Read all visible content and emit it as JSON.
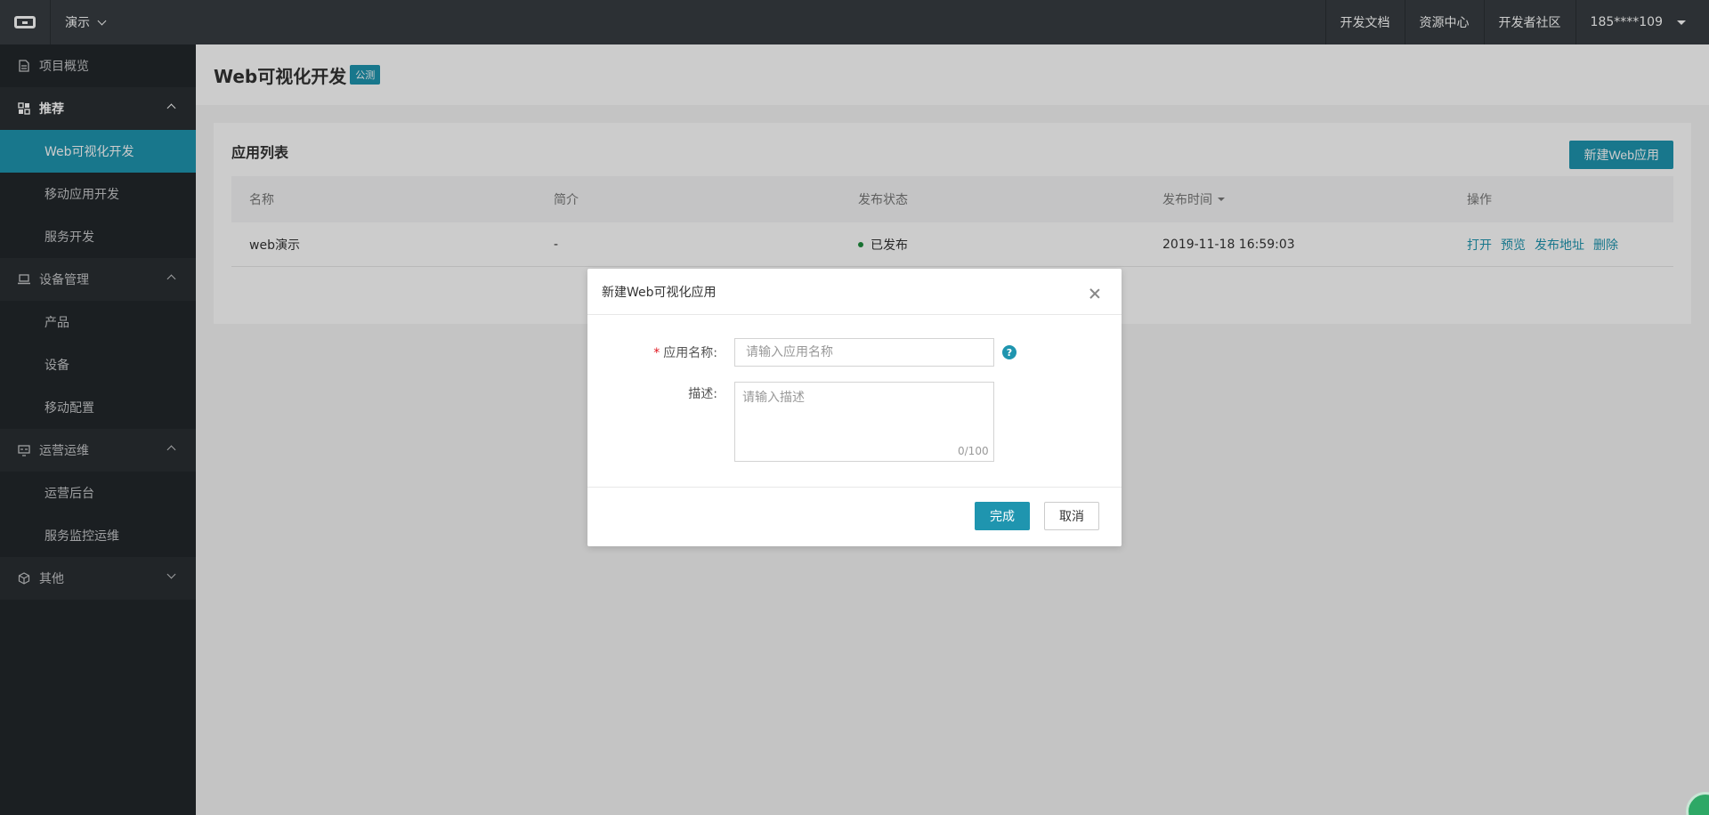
{
  "topbar": {
    "project": "演示",
    "links": [
      "开发文档",
      "资源中心",
      "开发者社区"
    ],
    "user": "185****109"
  },
  "sidebar": {
    "overview": "项目概览",
    "recommend": "推荐",
    "web_visual": "Web可视化开发",
    "mobile_dev": "移动应用开发",
    "service_dev": "服务开发",
    "device_mgmt": "设备管理",
    "product": "产品",
    "device": "设备",
    "mobile_config": "移动配置",
    "ops": "运营运维",
    "ops_backend": "运营后台",
    "service_monitor": "服务监控运维",
    "other": "其他"
  },
  "page": {
    "title": "Web可视化开发",
    "badge": "公测"
  },
  "card": {
    "title": "应用列表",
    "new_button": "新建Web应用",
    "columns": [
      "名称",
      "简介",
      "发布状态",
      "发布时间",
      "操作"
    ],
    "rows": [
      {
        "name": "web演示",
        "desc": "-",
        "status": "已发布",
        "time": "2019-11-18 16:59:03",
        "ops": [
          "打开",
          "预览",
          "发布地址",
          "删除"
        ]
      }
    ]
  },
  "modal": {
    "title": "新建Web可视化应用",
    "name_label": "应用名称:",
    "name_required": "*",
    "name_placeholder": "请输入应用名称",
    "help": "?",
    "desc_label": "描述:",
    "desc_placeholder": "请输入描述",
    "counter": "0/100",
    "ok": "完成",
    "cancel": "取消"
  },
  "colors": {
    "accent": "#1f95af",
    "topbar": "#373d41",
    "sidebar": "#22272b",
    "status_ok": "#1e8e3e"
  }
}
